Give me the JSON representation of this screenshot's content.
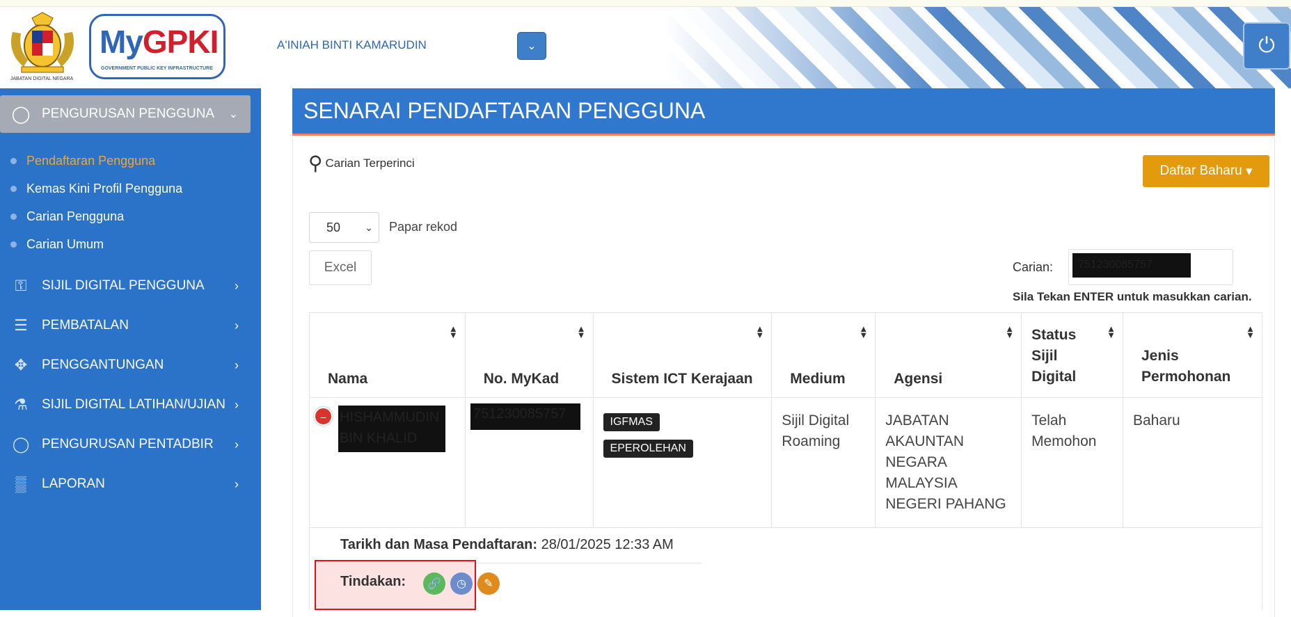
{
  "header": {
    "crest_caption": "JABATAN DIGITAL NEGARA",
    "logo_text_a": "My",
    "logo_text_b": "GPKI",
    "logo_sub": "GOVERNMENT PUBLIC KEY INFRASTRUCTURE",
    "username": "A'INIAH BINTI KAMARUDIN",
    "user_dropdown_icon": "chevron-down-icon",
    "power_icon": "power-icon"
  },
  "sidebar": {
    "section": "PENGURUSAN PENGGUNA",
    "subitems": [
      {
        "label": "Pendaftaran Pengguna",
        "active": true
      },
      {
        "label": "Kemas Kini Profil Pengguna",
        "active": false
      },
      {
        "label": "Carian Pengguna",
        "active": false
      },
      {
        "label": "Carian Umum",
        "active": false
      }
    ],
    "menus": [
      {
        "label": "SIJIL DIGITAL PENGGUNA",
        "icon": "key-icon"
      },
      {
        "label": "PEMBATALAN",
        "icon": "server-icon"
      },
      {
        "label": "PENGGANTUNGAN",
        "icon": "move-icon"
      },
      {
        "label": "SIJIL DIGITAL LATIHAN/UJIAN",
        "icon": "flask-icon"
      },
      {
        "label": "PENGURUSAN PENTADBIR",
        "icon": "user-icon"
      },
      {
        "label": "LAPORAN",
        "icon": "bar-chart-icon"
      }
    ]
  },
  "main": {
    "title": "SENARAI PENDAFTARAN PENGGUNA",
    "advanced_search": "Carian Terperinci",
    "new_button": "Daftar Baharu",
    "records_select": "50",
    "records_label": "Papar rekod",
    "excel_button": "Excel",
    "search_label": "Carian:",
    "search_value": "751230085757",
    "search_hint": "Sila Tekan ENTER untuk masukkan carian.",
    "columns": [
      "Nama",
      "No. MyKad",
      "Sistem ICT Kerajaan",
      "Medium",
      "Agensi",
      "Status Sijil Digital",
      "Jenis Permohonan"
    ],
    "row": {
      "nama": "HISHAMMUDIN BIN KHALID",
      "mykad": "751230085757",
      "sistem": [
        "IGFMAS",
        "EPEROLEHAN"
      ],
      "medium": "Sijil Digital Roaming",
      "agensi": "JABATAN AKAUNTAN NEGARA MALAYSIA NEGERI PAHANG",
      "status": "Telah Memohon",
      "jenis": "Baharu"
    },
    "detail": {
      "tarikh_label": "Tarikh dan Masa Pendaftaran:",
      "tarikh_value": "28/01/2025 12:33 AM",
      "tindakan_label": "Tindakan:"
    },
    "colors": {
      "sidebar": "#2b72c9",
      "title_bar": "#2f78ce",
      "active_link": "#f3a52c",
      "new_button": "#e39a0d",
      "action_link": "#5cb85c",
      "action_history": "#6d8ccd",
      "action_edit": "#e08a1e"
    }
  }
}
